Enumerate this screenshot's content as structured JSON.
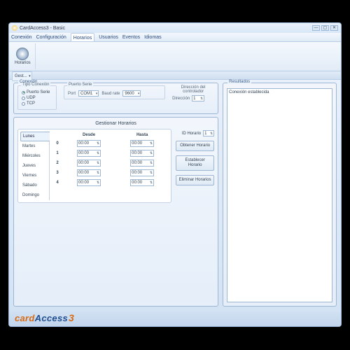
{
  "window": {
    "title": "CardAccess3 - Basic"
  },
  "menu": {
    "items": [
      "Conexión",
      "Configuración",
      "Horarios",
      "Usuarios",
      "Eventos",
      "Idiomas"
    ],
    "active": 2
  },
  "ribbon": {
    "item_label": "Horarios"
  },
  "toolbar": {
    "dropdown": "Gest..."
  },
  "connection": {
    "group_label": "Conexión",
    "type_label": "Tipo Conexión",
    "options": {
      "serial": "Puerto Serie",
      "udp": "UDP",
      "tcp": "TCP"
    },
    "serial_group": "Puerto Serie",
    "port_label": "Port",
    "port_value": "COM1",
    "baud_label": "Baud rate",
    "baud_value": "9600",
    "controller_label": "Dirección del controlador",
    "address_label": "Dirección",
    "address_value": "1"
  },
  "schedules": {
    "title": "Gestionar Horarios",
    "id_label": "ID Horario",
    "id_value": "1",
    "col_from": "Desde",
    "col_to": "Hasta",
    "days": [
      "Lunes",
      "Martes",
      "Miércoles",
      "Jueves",
      "Viernes",
      "Sábado",
      "Domingo"
    ],
    "rows": [
      {
        "idx": "0",
        "from": "00:00",
        "to": "00:00"
      },
      {
        "idx": "1",
        "from": "00:00",
        "to": "00:00"
      },
      {
        "idx": "2",
        "from": "00:00",
        "to": "00:00"
      },
      {
        "idx": "3",
        "from": "00:00",
        "to": "00:00"
      },
      {
        "idx": "4",
        "from": "00:00",
        "to": "00:00"
      }
    ],
    "btn_get": "Obtener Horario",
    "btn_set": "Establecer Horario",
    "btn_del": "Eliminar Horarios"
  },
  "results": {
    "label": "Resultados",
    "text": "Conexión establecida"
  },
  "brand": {
    "p1": "card",
    "p2": "Access",
    "p3": "3"
  }
}
